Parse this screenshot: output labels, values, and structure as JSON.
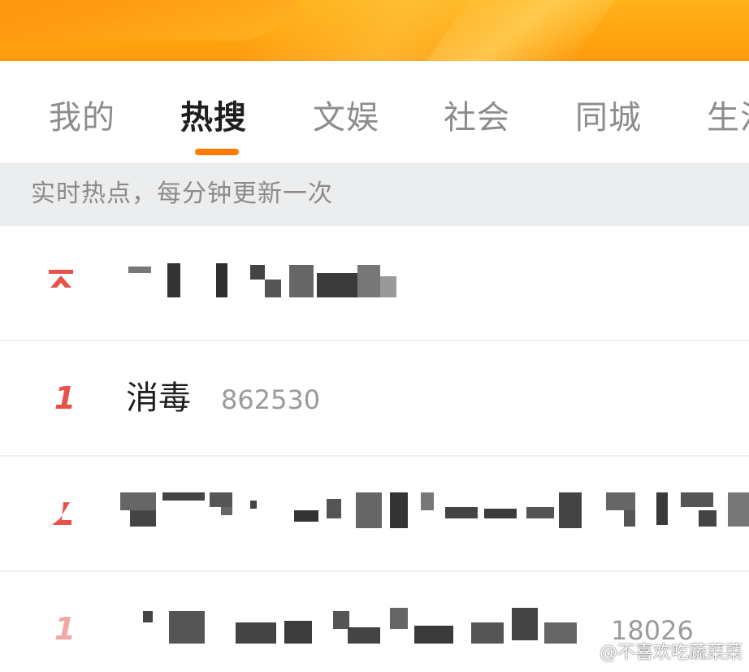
{
  "tabs": [
    {
      "label": "我的",
      "active": false
    },
    {
      "label": "热搜",
      "active": true
    },
    {
      "label": "文娱",
      "active": false
    },
    {
      "label": "社会",
      "active": false
    },
    {
      "label": "同城",
      "active": false
    },
    {
      "label": "生活",
      "active": false
    }
  ],
  "notice": "实时热点，每分钟更新一次",
  "list": [
    {
      "rank_icon": "pinned-top-icon",
      "title": "",
      "count": ""
    },
    {
      "rank": "1",
      "title": "消毒",
      "count": "862530"
    },
    {
      "rank": "2",
      "title": "",
      "count": ""
    },
    {
      "rank": "1",
      "title": "",
      "count": "18026"
    }
  ],
  "watermark": "@不喜欢吃蔬菜菜",
  "colors": {
    "accent": "#ff7a00",
    "rank_red": "#e8524a",
    "banner": "#ffa20e",
    "notice_bg": "#ecedee"
  }
}
